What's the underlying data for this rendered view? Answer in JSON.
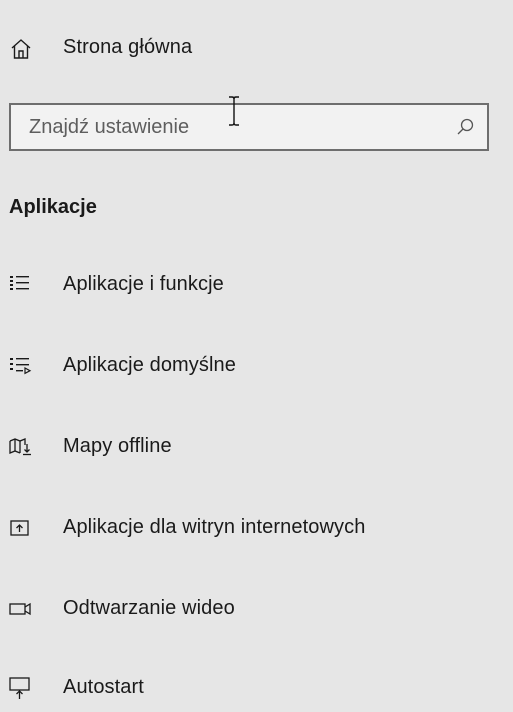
{
  "home": {
    "label": "Strona główna",
    "icon": "home-icon"
  },
  "search": {
    "placeholder": "Znajdź ustawienie",
    "icon": "search-icon"
  },
  "section": {
    "title": "Aplikacje"
  },
  "items": [
    {
      "label": "Aplikacje i funkcje",
      "icon": "apps-list-icon"
    },
    {
      "label": "Aplikacje domyślne",
      "icon": "default-apps-icon"
    },
    {
      "label": "Mapy offline",
      "icon": "offline-maps-icon"
    },
    {
      "label": "Aplikacje dla witryn internetowych",
      "icon": "apps-for-websites-icon"
    },
    {
      "label": "Odtwarzanie wideo",
      "icon": "video-playback-icon"
    },
    {
      "label": "Autostart",
      "icon": "startup-icon"
    }
  ]
}
